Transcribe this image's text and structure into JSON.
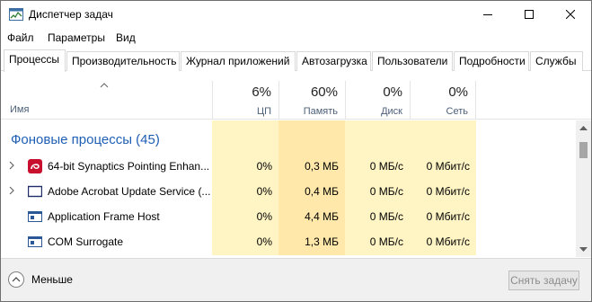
{
  "window": {
    "title": "Диспетчер задач"
  },
  "menu": [
    "Файл",
    "Параметры",
    "Вид"
  ],
  "tabs": [
    {
      "label": "Процессы",
      "active": true
    },
    {
      "label": "Производительность"
    },
    {
      "label": "Журнал приложений"
    },
    {
      "label": "Автозагрузка"
    },
    {
      "label": "Пользователи"
    },
    {
      "label": "Подробности"
    },
    {
      "label": "Службы"
    }
  ],
  "columns": {
    "name": "Имя",
    "cpu": {
      "percent": "6%",
      "label": "ЦП"
    },
    "memory": {
      "percent": "60%",
      "label": "Память"
    },
    "disk": {
      "percent": "0%",
      "label": "Диск"
    },
    "network": {
      "percent": "0%",
      "label": "Сеть"
    }
  },
  "group": {
    "title": "Фоновые процессы (45)"
  },
  "rows": [
    {
      "name": "64-bit Synaptics Pointing Enhan...",
      "icon": "synaptics-icon",
      "expandable": true,
      "cpu": "0%",
      "memory": "0,3 МБ",
      "disk": "0 МБ/с",
      "network": "0 Мбит/с"
    },
    {
      "name": "Adobe Acrobat Update Service (...",
      "icon": "window-icon",
      "expandable": true,
      "cpu": "0%",
      "memory": "0,4 МБ",
      "disk": "0 МБ/с",
      "network": "0 Мбит/с"
    },
    {
      "name": "Application Frame Host",
      "icon": "app-frame-icon",
      "expandable": false,
      "cpu": "0%",
      "memory": "4,4 МБ",
      "disk": "0 МБ/с",
      "network": "0 Мбит/с"
    },
    {
      "name": "COM Surrogate",
      "icon": "app-frame-icon",
      "expandable": false,
      "cpu": "0%",
      "memory": "1,3 МБ",
      "disk": "0 МБ/с",
      "network": "0 Мбит/с"
    }
  ],
  "footer": {
    "less_label": "Меньше",
    "end_task_label": "Снять задачу"
  },
  "colors": {
    "heat_light": "#fff4c4",
    "heat_medium": "#ffe8a9",
    "group_title": "#1f5fb4"
  }
}
